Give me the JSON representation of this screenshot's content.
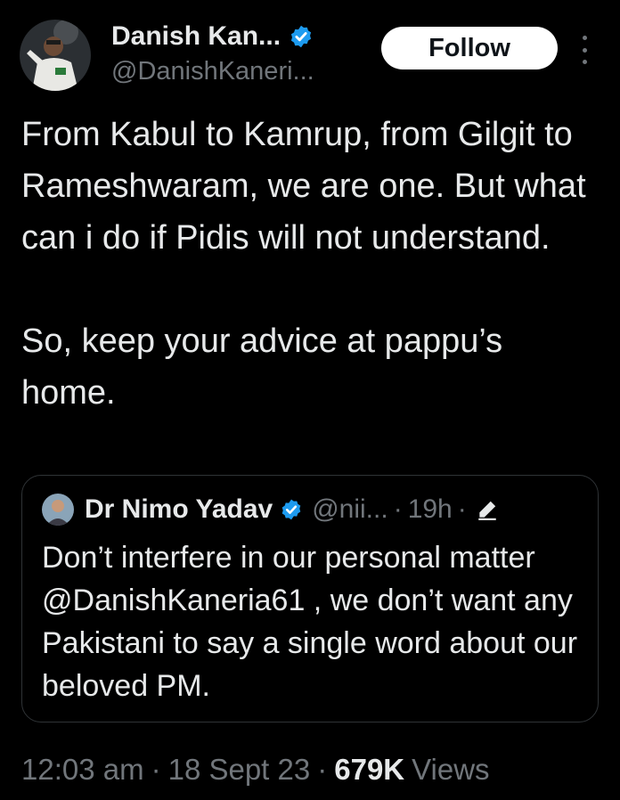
{
  "author": {
    "display_name": "Danish Kan...",
    "handle": "@DanishKaneri...",
    "verified_icon": "verified-badge-icon",
    "avatar_icon": "profile-photo"
  },
  "actions": {
    "follow_label": "Follow",
    "more_icon": "more-vertical-icon"
  },
  "tweet": {
    "paragraph_1": "From Kabul to Kamrup, from Gilgit to Rameshwaram, we are one. But what can i do if Pidis will not understand.",
    "paragraph_2": "So, keep your advice at pappu’s home."
  },
  "quoted_tweet": {
    "display_name": "Dr Nimo Yadav",
    "handle": "@nii...",
    "separator": "·",
    "time": "19h",
    "edited_icon": "edit-pencil-icon",
    "text": "Don’t interfere in our personal matter @DanishKaneria61 , we don’t want any Pakistani to say a single word about our beloved PM."
  },
  "meta": {
    "time": "12:03 am",
    "separator": "·",
    "date": "18 Sept 23",
    "views_count": "679K",
    "views_label": "Views"
  },
  "colors": {
    "background": "#000000",
    "text_primary": "#e7e9ea",
    "text_secondary": "#71767b",
    "verified_blue": "#1d9bf0",
    "border": "#2f3336",
    "follow_bg": "#ffffff"
  }
}
